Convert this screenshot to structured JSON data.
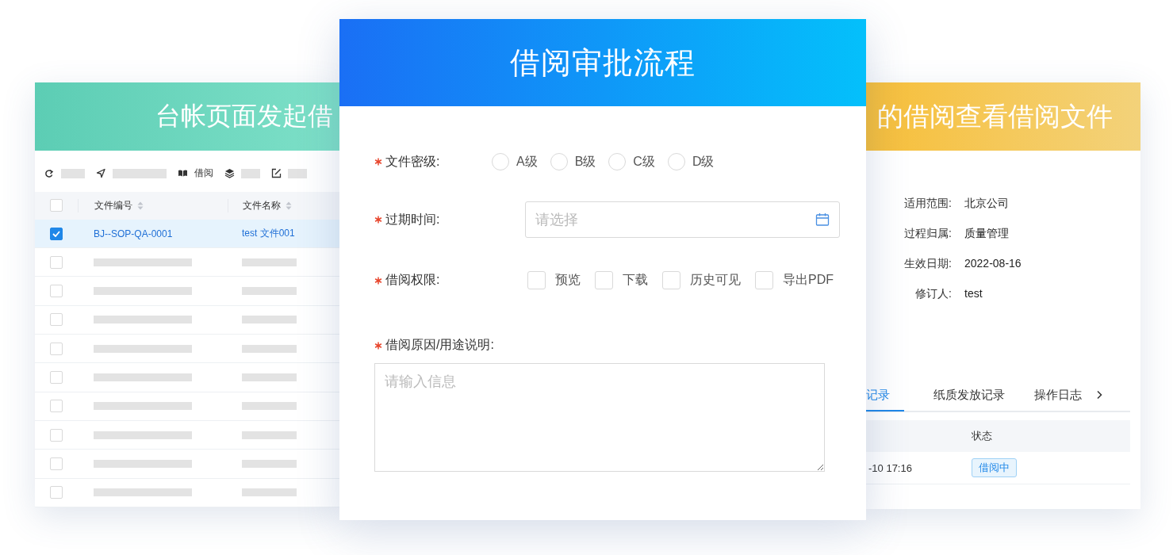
{
  "ledger_card": {
    "title": "台帐页面发起借",
    "toolbar": [
      {
        "kind": "placeholder"
      },
      {
        "kind": "placeholder"
      },
      {
        "kind": "label",
        "label": "借阅"
      },
      {
        "kind": "placeholder"
      },
      {
        "kind": "placeholder"
      }
    ],
    "table": {
      "header_checked": false,
      "columns": [
        {
          "label": "文件编号"
        },
        {
          "label": "文件名称"
        }
      ],
      "rows": [
        {
          "kind": "text",
          "selected": true,
          "checked": true,
          "cells": [
            "BJ--SOP-QA-0001",
            "test 文件001"
          ]
        },
        {
          "kind": "placeholder",
          "selected": false,
          "checked": false
        },
        {
          "kind": "placeholder",
          "selected": false,
          "checked": false
        },
        {
          "kind": "placeholder",
          "selected": false,
          "checked": false
        },
        {
          "kind": "placeholder",
          "selected": false,
          "checked": false
        },
        {
          "kind": "placeholder",
          "selected": false,
          "checked": false
        },
        {
          "kind": "placeholder",
          "selected": false,
          "checked": false
        },
        {
          "kind": "placeholder",
          "selected": false,
          "checked": false
        },
        {
          "kind": "placeholder",
          "selected": false,
          "checked": false
        },
        {
          "kind": "placeholder",
          "selected": false,
          "checked": false
        }
      ]
    }
  },
  "approval_card": {
    "title": "借阅审批流程",
    "fields": [
      {
        "kind": "radio",
        "label": "文件密级:",
        "required": true,
        "options": [
          {
            "label": "A级",
            "selected": false
          },
          {
            "label": "B级",
            "selected": false
          },
          {
            "label": "C级",
            "selected": false
          },
          {
            "label": "D级",
            "selected": false
          }
        ]
      },
      {
        "kind": "date",
        "label": "过期时间:",
        "required": true,
        "placeholder": "请选择"
      },
      {
        "kind": "checkbox",
        "label": "借阅权限:",
        "required": true,
        "options": [
          {
            "label": "预览",
            "checked": false
          },
          {
            "label": "下载",
            "checked": false
          },
          {
            "label": "历史可见",
            "checked": false
          },
          {
            "label": "导出PDF",
            "checked": false
          }
        ]
      },
      {
        "kind": "textarea",
        "label": "借阅原因/用途说明:",
        "required": true,
        "placeholder": "请输入信息"
      }
    ]
  },
  "my_borrow_card": {
    "title": "的借阅查看借阅文件",
    "details": [
      {
        "label": "适用范围:",
        "value": "北京公司"
      },
      {
        "label": "过程归属:",
        "value": "质量管理"
      },
      {
        "label": "生效日期:",
        "value": "2022-08-16"
      },
      {
        "label": "修订人:",
        "value": "test"
      }
    ],
    "tabs": [
      {
        "label": "记录",
        "selected": true
      },
      {
        "label": "纸质发放记录",
        "selected": false
      },
      {
        "label": "操作日志",
        "selected": false
      }
    ],
    "table": {
      "status_header": "状态",
      "rows": [
        {
          "column_1": "-10 17:16",
          "status": "借阅中"
        }
      ]
    }
  }
}
